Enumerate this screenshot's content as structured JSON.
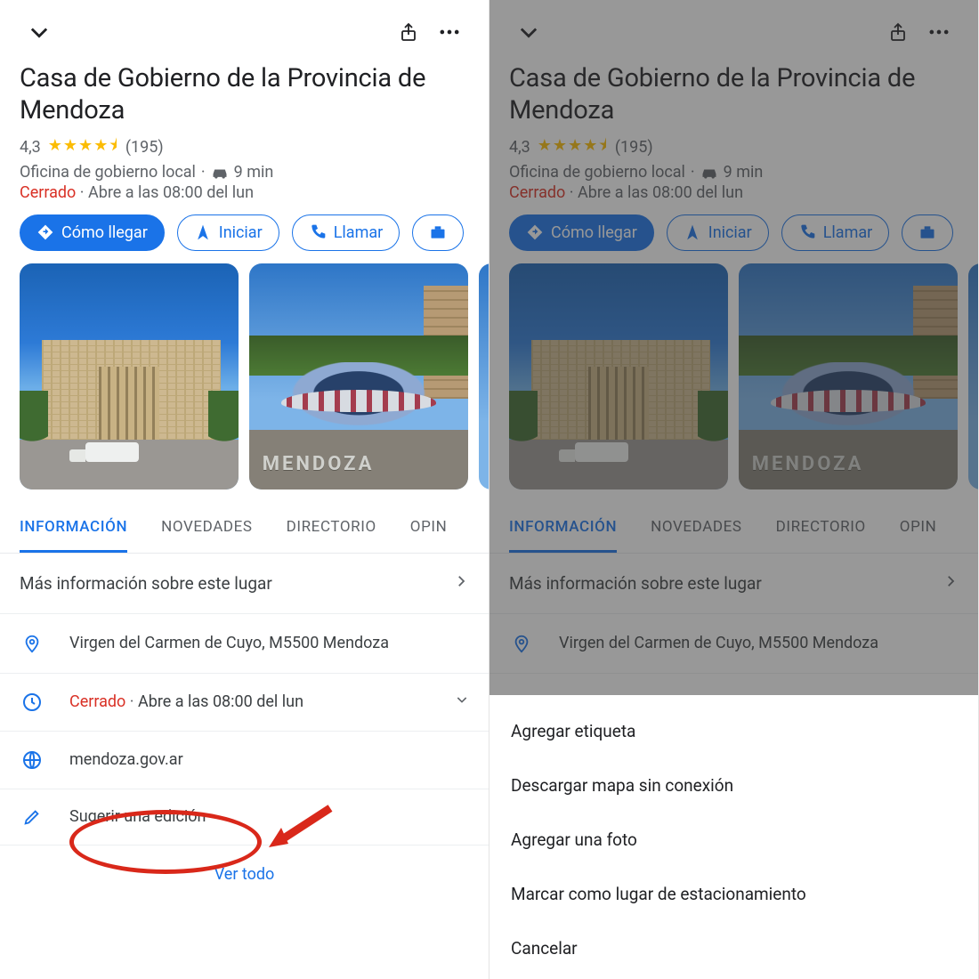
{
  "place": {
    "title": "Casa de Gobierno de la Provincia de Mendoza",
    "rating_value": "4,3",
    "rating_count": "(195)",
    "category": "Oficina de gobierno local",
    "drive_time": "9 min",
    "status_closed": "Cerrado",
    "status_opens": "Abre a las 08:00 del lun"
  },
  "actions": {
    "directions": "Cómo llegar",
    "start": "Iniciar",
    "call": "Llamar"
  },
  "tabs": {
    "info": "INFORMACIÓN",
    "news": "NOVEDADES",
    "directory": "DIRECTORIO",
    "reviews_partial": "OPIN"
  },
  "more_info": "Más información sobre este lugar",
  "details": {
    "address": "Virgen del Carmen de Cuyo, M5500 Mendoza",
    "hours_closed": "Cerrado",
    "hours_opens": "Abre a las 08:00 del lun",
    "website": "mendoza.gov.ar",
    "suggest_edit": "Sugerir una edición"
  },
  "see_all": "Ver todo",
  "photos": {
    "letters": "MENDOZA"
  },
  "sheet": {
    "add_label": "Agregar etiqueta",
    "download_offline": "Descargar mapa sin conexión",
    "add_photo": "Agregar una foto",
    "mark_parking": "Marcar como lugar de estacionamiento",
    "cancel": "Cancelar"
  }
}
